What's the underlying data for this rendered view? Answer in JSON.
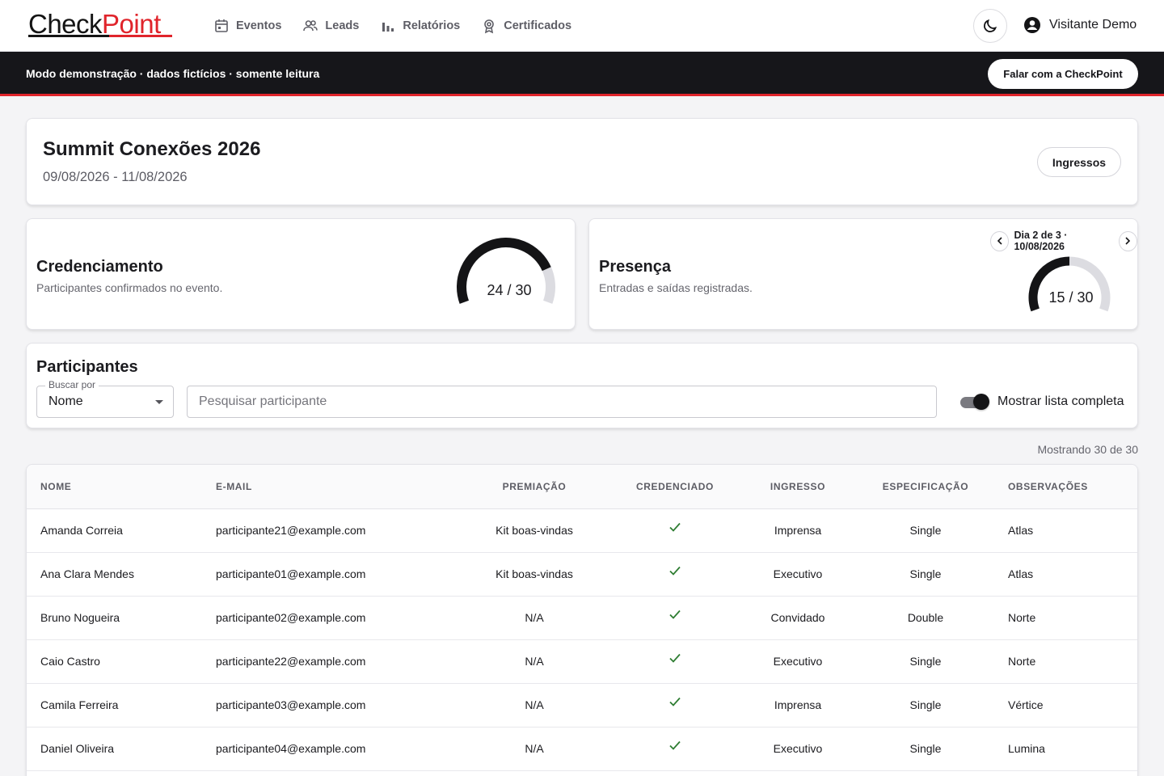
{
  "brand": {
    "logo_part1": "Check",
    "logo_part2": "Point",
    "accent": "#e0242b"
  },
  "nav": [
    {
      "label": "Eventos",
      "icon": "calendar-icon"
    },
    {
      "label": "Leads",
      "icon": "users-icon"
    },
    {
      "label": "Relatórios",
      "icon": "bar-chart-icon"
    },
    {
      "label": "Certificados",
      "icon": "award-icon"
    }
  ],
  "user": {
    "name": "Visitante Demo",
    "icon": "user-circle-icon"
  },
  "theme_icon": "moon-icon",
  "banner": {
    "text": "Modo demonstração · dados fictícios · somente leitura",
    "button": "Falar com a CheckPoint"
  },
  "event": {
    "title": "Summit Conexões 2026",
    "dates": "09/08/2026 - 11/08/2026",
    "tickets_button": "Ingressos"
  },
  "credenciamento": {
    "title": "Credenciamento",
    "subtitle": "Participantes confirmados no evento.",
    "value": 24,
    "total": 30,
    "label": "24 / 30"
  },
  "presenca": {
    "title": "Presença",
    "subtitle": "Entradas e saídas registradas.",
    "day_label": "Dia 2 de 3 · 10/08/2026",
    "value": 15,
    "total": 30,
    "label": "15 / 30"
  },
  "participantes": {
    "title": "Participantes",
    "search_by_label": "Buscar por",
    "search_by_value": "Nome",
    "search_placeholder": "Pesquisar participante",
    "toggle_label": "Mostrar lista completa",
    "toggle_on": true,
    "count_text": "Mostrando 30 de 30"
  },
  "table": {
    "headers": [
      "Nome",
      "E-mail",
      "Premiação",
      "Credenciado",
      "Ingresso",
      "Especificação",
      "Observações"
    ],
    "rows": [
      [
        "Amanda Correia",
        "participante21@example.com",
        "Kit boas-vindas",
        "check",
        "Imprensa",
        "Single",
        "Atlas"
      ],
      [
        "Ana Clara Mendes",
        "participante01@example.com",
        "Kit boas-vindas",
        "check",
        "Executivo",
        "Single",
        "Atlas"
      ],
      [
        "Bruno Nogueira",
        "participante02@example.com",
        "N/A",
        "check",
        "Convidado",
        "Double",
        "Norte"
      ],
      [
        "Caio Castro",
        "participante22@example.com",
        "N/A",
        "check",
        "Executivo",
        "Single",
        "Norte"
      ],
      [
        "Camila Ferreira",
        "participante03@example.com",
        "N/A",
        "check",
        "Imprensa",
        "Single",
        "Vértice"
      ],
      [
        "Daniel Oliveira",
        "participante04@example.com",
        "N/A",
        "check",
        "Executivo",
        "Single",
        "Lumina"
      ]
    ]
  }
}
